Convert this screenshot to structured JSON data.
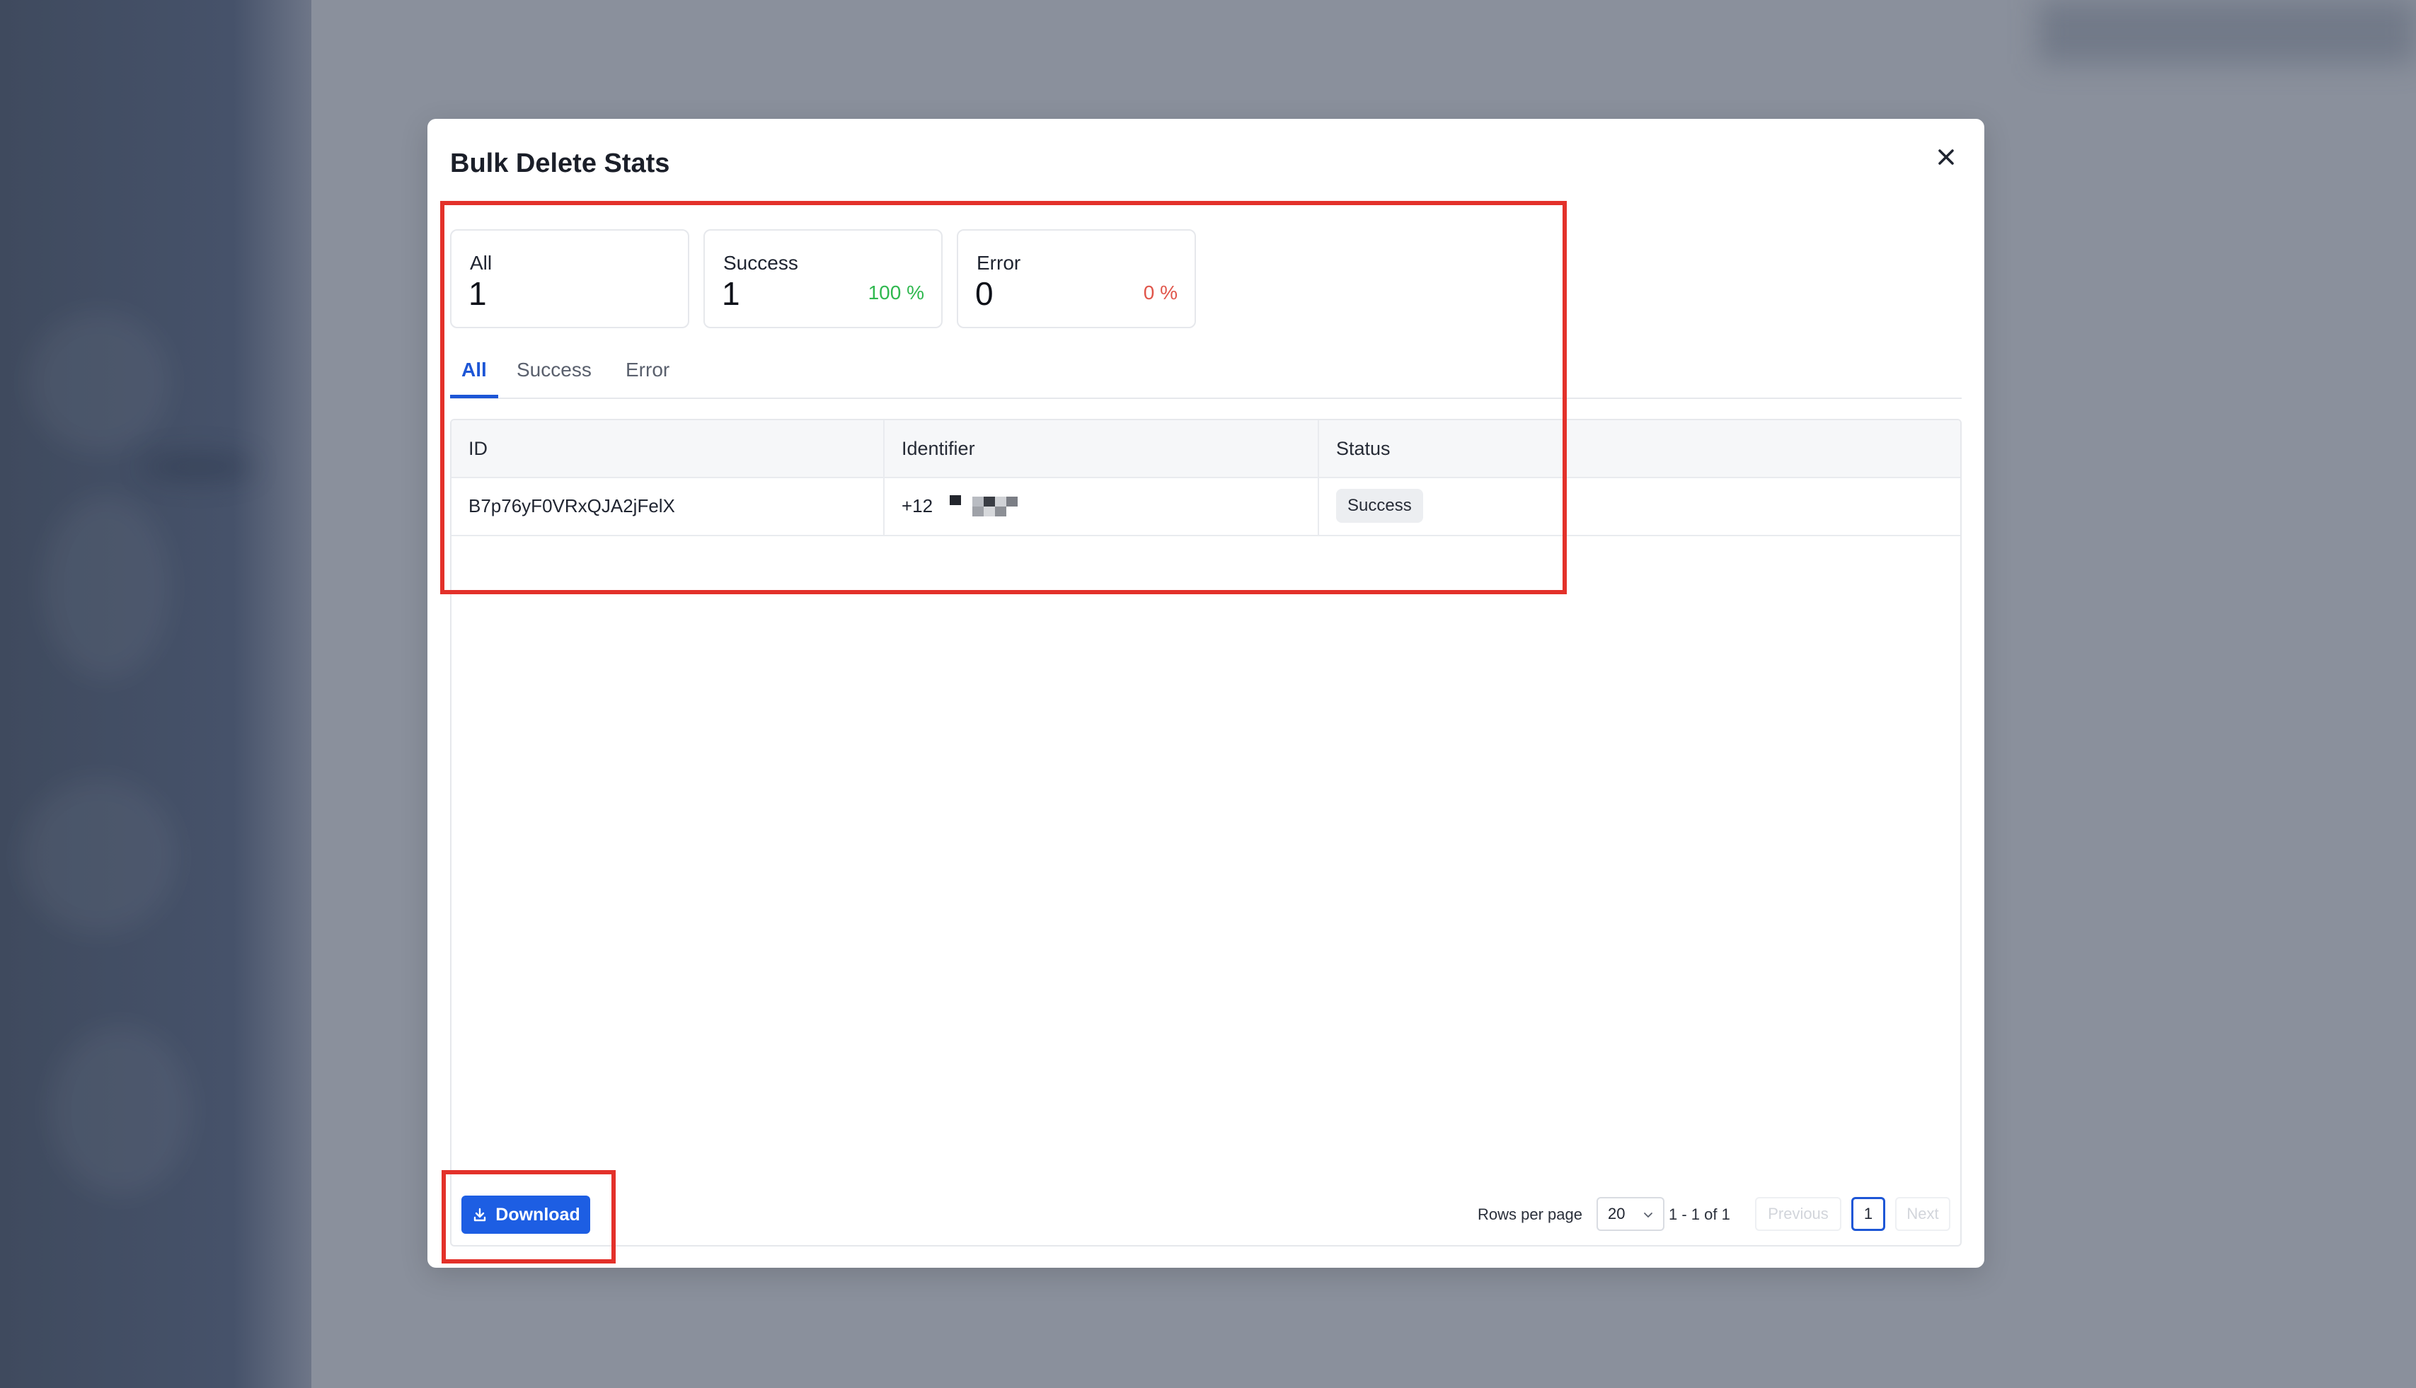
{
  "modal": {
    "title": "Bulk Delete Stats"
  },
  "stats": {
    "all": {
      "label": "All",
      "value": "1"
    },
    "success": {
      "label": "Success",
      "value": "1",
      "percent": "100 %"
    },
    "error": {
      "label": "Error",
      "value": "0",
      "percent": "0 %"
    }
  },
  "tabs": [
    {
      "label": "All",
      "active": true
    },
    {
      "label": "Success",
      "active": false
    },
    {
      "label": "Error",
      "active": false
    }
  ],
  "table": {
    "headers": [
      "ID",
      "Identifier",
      "Status"
    ],
    "rows": [
      {
        "id": "B7p76yF0VRxQJA2jFelX",
        "identifier_prefix": "+12",
        "status": "Success"
      }
    ]
  },
  "footer": {
    "download_label": "Download",
    "rows_per_page_label": "Rows per page",
    "rows_per_page_value": "20",
    "range_text": "1 - 1 of 1",
    "previous_label": "Previous",
    "current_page": "1",
    "next_label": "Next"
  },
  "colors": {
    "accent": "#1d56d6",
    "success": "#2fb84f",
    "error": "#e0554a",
    "annotation": "#e3312a"
  }
}
